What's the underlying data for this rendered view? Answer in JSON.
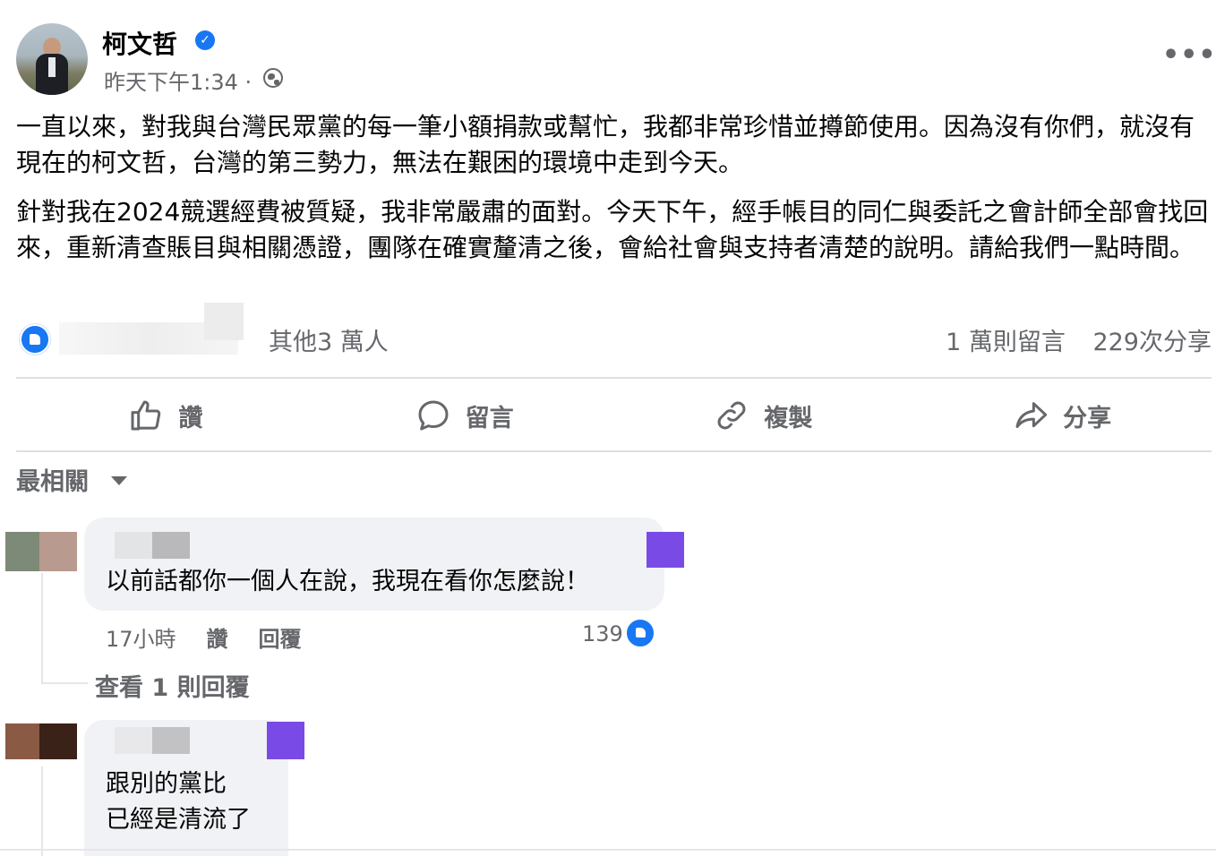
{
  "post": {
    "author": "柯文哲",
    "timestamp": "昨天下午1:34 ·",
    "paragraphs": [
      "一直以來，對我與台灣民眾黨的每一筆小額捐款或幫忙，我都非常珍惜並撙節使用。因為沒有你們，就沒有現在的柯文哲，台灣的第三勢力，無法在艱困的環境中走到今天。",
      "針對我在2024競選經費被質疑，我非常嚴肅的面對。今天下午，經手帳目的同仁與委託之會計師全部會找回來，重新清查賬目與相關憑證，團隊在確實釐清之後，會給社會與支持者清楚的說明。請給我們一點時間。"
    ]
  },
  "stats": {
    "reactors": "其他3 萬人",
    "comments": "1 萬則留言",
    "shares": "229次分享"
  },
  "actions": {
    "like": "讚",
    "comment": "留言",
    "copy": "複製",
    "share": "分享"
  },
  "sort_label": "最相關",
  "comments": [
    {
      "text": "以前話都你一個人在說，我現在看你怎麼說！",
      "time": "17小時",
      "like_label": "讚",
      "reply_label": "回覆",
      "like_count": "139",
      "view_replies": "查看 1 則回覆"
    },
    {
      "text_line1": "跟別的黨比",
      "text_line2": "已經是清流了"
    }
  ],
  "colors": {
    "accent": "#1877f2",
    "secondary_text": "#65676b",
    "bubble": "#f0f2f5"
  }
}
